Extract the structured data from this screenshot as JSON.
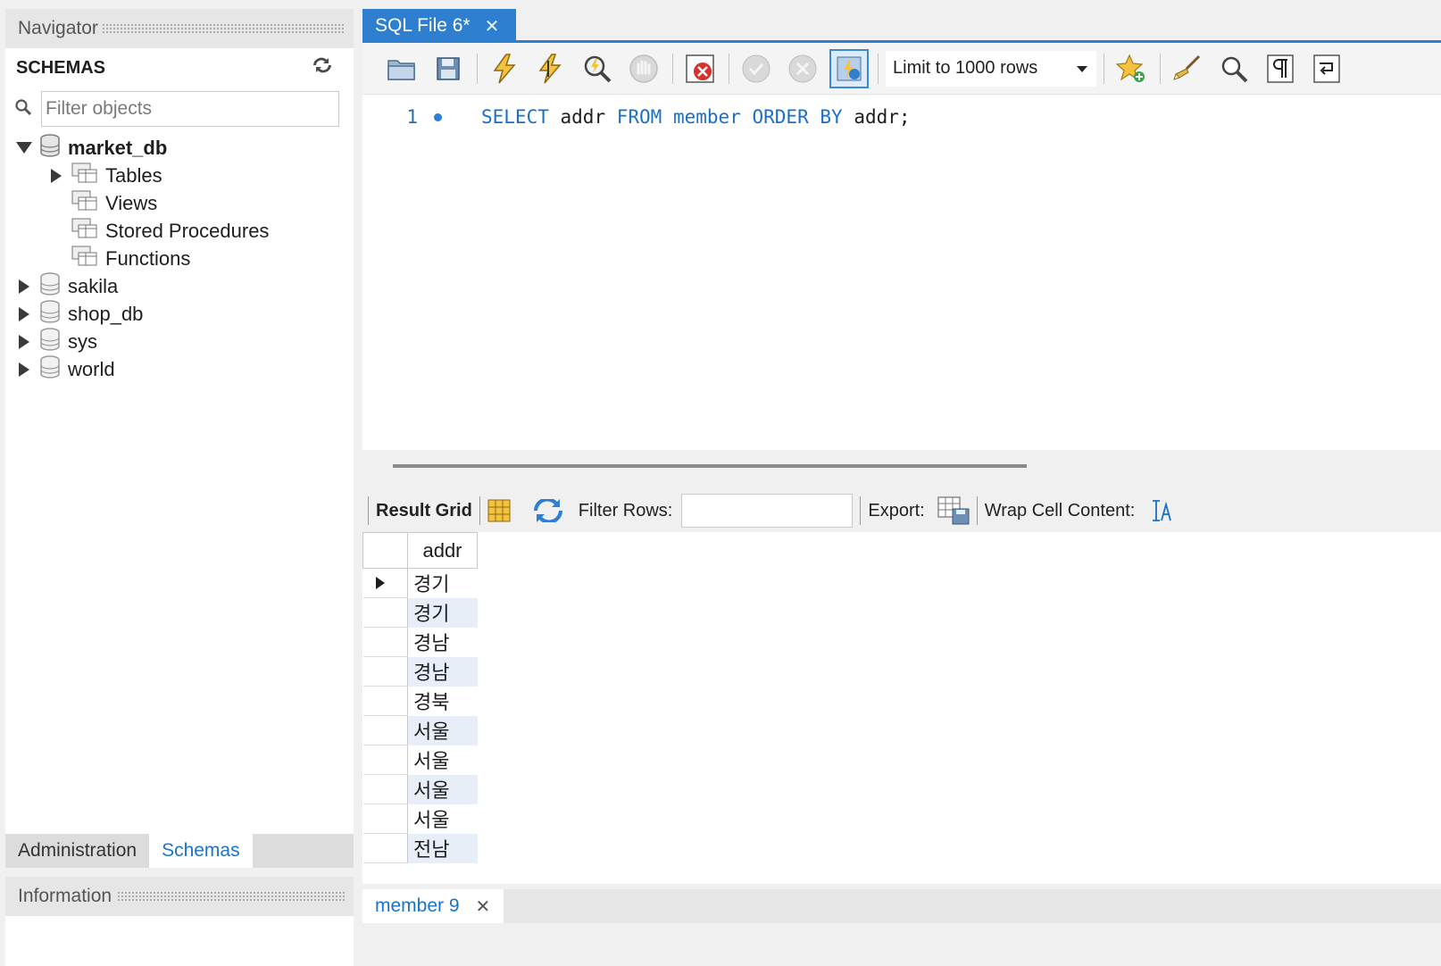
{
  "navigator": {
    "title": "Navigator",
    "schemas_label": "SCHEMAS",
    "filter_placeholder": "Filter objects",
    "tree": {
      "market_db": {
        "name": "market_db",
        "children": [
          "Tables",
          "Views",
          "Stored Procedures",
          "Functions"
        ]
      },
      "others": [
        "sakila",
        "shop_db",
        "sys",
        "world"
      ]
    },
    "tabs": [
      "Administration",
      "Schemas"
    ],
    "info_title": "Information"
  },
  "editor": {
    "tab_title": "SQL File 6*",
    "limit_label": "Limit to 1000 rows",
    "line_number": "1",
    "sql_tokens": [
      "SELECT",
      "addr",
      "FROM",
      "member",
      "ORDER",
      "BY",
      "addr;"
    ]
  },
  "result": {
    "toolbar": {
      "grid_label": "Result Grid",
      "filter_label": "Filter Rows:",
      "export_label": "Export:",
      "wrap_label": "Wrap Cell Content:"
    },
    "columns": [
      "addr"
    ],
    "rows": [
      "경기",
      "경기",
      "경남",
      "경남",
      "경북",
      "서울",
      "서울",
      "서울",
      "서울",
      "전남"
    ],
    "tab_label": "member 9"
  }
}
